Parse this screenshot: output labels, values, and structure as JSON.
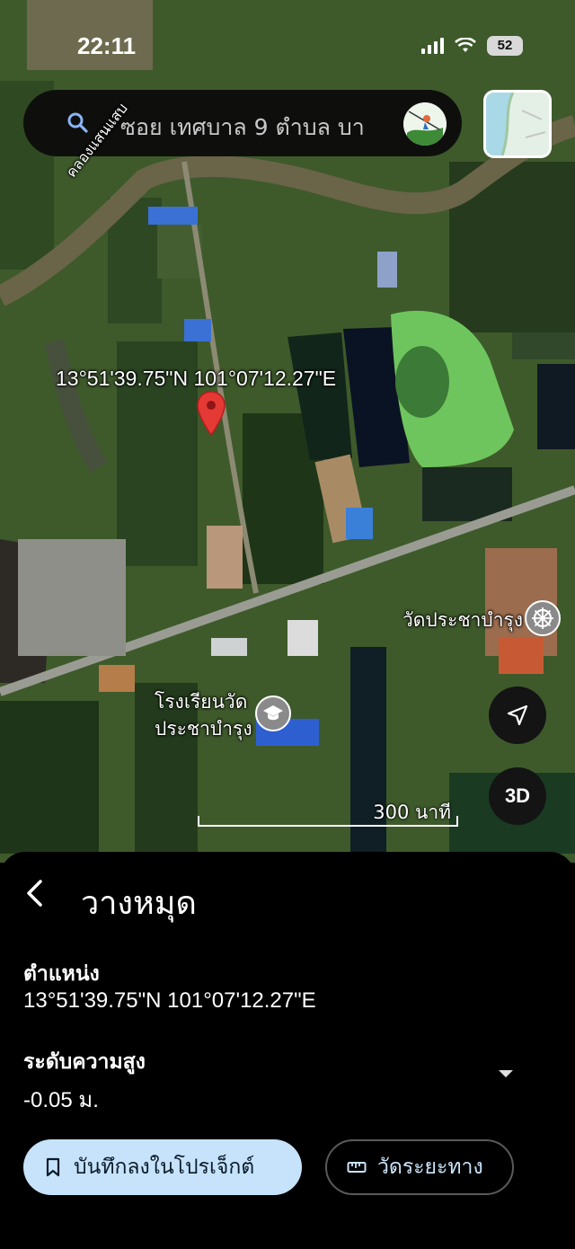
{
  "status_bar": {
    "time": "22:11",
    "battery": "52"
  },
  "search": {
    "query": "ซอย เทศบาล 9 ตำบล บา"
  },
  "map": {
    "pin_coordinates_label": "13°51'39.75\"N 101°07'12.27\"E",
    "canal_label": "คลองแสนแสบ",
    "school_label_line1": "โรงเรียนวัด",
    "school_label_line2": "ประชาบำรุง",
    "temple_label": "วัดประชาบำรุง",
    "scale_label": "300 นาที",
    "three_d_label": "3D",
    "accent_pin_color": "#e53935"
  },
  "sheet": {
    "title": "วางหมุด",
    "location_label": "ตำแหน่ง",
    "location_value": "13°51'39.75\"N 101°07'12.27\"E",
    "elevation_label": "ระดับความสูง",
    "elevation_value": "-0.05 ม.",
    "save_button": "บันทึกลงในโปรเจ็กต์",
    "measure_button": "วัดระยะทาง",
    "save_button_color": "#c6e3fb"
  },
  "icons": [
    "search-icon",
    "avatar-icon",
    "map-layer-thumbnail",
    "map-pin-icon",
    "school-icon",
    "dharma-wheel-icon",
    "navigation-arrow-icon",
    "back-chevron-icon",
    "expand-chevron-icon",
    "bookmark-icon",
    "ruler-icon"
  ]
}
